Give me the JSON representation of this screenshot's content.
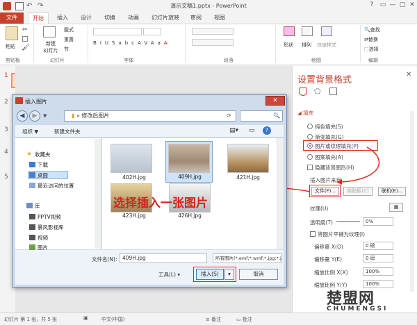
{
  "app": {
    "title": "演示文稿1.pptx - PowerPoint",
    "window_controls": [
      "?",
      "▭",
      "—",
      "▢",
      "✕"
    ]
  },
  "ribbon": {
    "tabs": [
      "文件",
      "开始",
      "插入",
      "设计",
      "切换",
      "动画",
      "幻灯片放映",
      "审阅",
      "视图"
    ],
    "active_tab": "开始",
    "clipboard": {
      "paste": "粘贴",
      "label": "剪贴板"
    },
    "slides": {
      "new_slide": "新建\n幻灯片",
      "layout": "版式",
      "reset": "重置",
      "section": "节",
      "label": "幻灯片"
    },
    "font_label": "字体",
    "paragraph_label": "段落",
    "drawing": {
      "shape": "形状",
      "arrange": "排列",
      "quick_style": "快速样式",
      "label": "绘图"
    },
    "editing": {
      "find": "查找",
      "replace": "替换",
      "select": "选择",
      "label": "编辑"
    },
    "font_buttons": [
      "B",
      "I",
      "U",
      "S",
      "abc",
      "AV",
      "Aa",
      "A"
    ]
  },
  "slide_panel": {
    "numbers": [
      "1",
      "2",
      "3",
      "4",
      "5"
    ]
  },
  "pane": {
    "title": "设置背景格式",
    "section": "填充",
    "options": [
      "纯色填充(S)",
      "渐变填充(G)",
      "图片或纹理填充(P)",
      "图案填充(A)"
    ],
    "selected_option": "图片或纹理填充(P)",
    "hide_graphics": "隐藏背景图形(H)",
    "insert_from": "插入图片来自",
    "file_btn": "文件(F)...",
    "clipboard_btn": "剪贴板(C)",
    "online_btn": "联机(E)...",
    "texture": "纹理(U)",
    "transparency": "透明度(T)",
    "transparency_value": "0%",
    "tile": "将图片平铺为纹理(I)",
    "offset_x": "偏移量 X(O)",
    "offset_x_value": "0 磅",
    "offset_y": "偏移量 Y(E)",
    "offset_y_value": "0 磅",
    "scale_x": "缩放比例 X(X)",
    "scale_x_value": "100%",
    "scale_y": "缩放比例 Y(Y)",
    "scale_y_value": "100%"
  },
  "dialog": {
    "title": "插入图片",
    "path": "修改后图片",
    "organize": "组织 ▼",
    "new_folder": "新建文件夹",
    "tree": [
      {
        "label": "收藏夹",
        "icon": "star-icon"
      },
      {
        "label": "下载",
        "icon": "download-folder-icon"
      },
      {
        "label": "桌面",
        "icon": "desktop-icon"
      },
      {
        "label": "最近访问的位置",
        "icon": "recent-icon"
      },
      {
        "label": "库",
        "icon": "library-icon"
      },
      {
        "label": "PPTV视频",
        "icon": "video-folder-icon"
      },
      {
        "label": "暴风影视库",
        "icon": "video-folder-icon"
      },
      {
        "label": "视频",
        "icon": "video-folder-icon"
      },
      {
        "label": "图片",
        "icon": "picture-folder-icon"
      }
    ],
    "files": [
      "402H.jpg",
      "409H.jpg",
      "421H.jpg",
      "423H.jpg",
      "426H.jpg"
    ],
    "selected_file": "409H.jpg",
    "filename_label": "文件名(N):",
    "filename_value": "409H.jpg",
    "filetype_value": "所有图片(*.emf;*.wmf;*.jpg;*.jp",
    "tools": "工具(L)",
    "insert_btn": "插入(S)",
    "cancel_btn": "取消"
  },
  "annotation": "选择插入一张图片",
  "status": {
    "slide_info": "幻灯片 第 1 张，共 5 张",
    "language": "中文(中国)",
    "notes": "备注",
    "comments": "批注"
  },
  "watermark": {
    "main": "楚盟网",
    "sub": "CHUMENGSI"
  },
  "colors": {
    "accent": "#c6412b",
    "annotation": "#d0261e"
  }
}
